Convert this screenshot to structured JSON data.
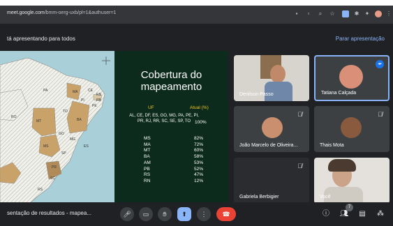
{
  "browser": {
    "url_host": "meet.google.com",
    "url_rest": "/bmm-oerg-uxb/pl=1&authuser=1"
  },
  "presenting": {
    "text": "tá apresentando para todos",
    "stop_label": "Parar apresentação"
  },
  "slide": {
    "title_line1": "Cobertura do",
    "title_line2": "mapeamento",
    "col_uf": "UF",
    "col_atual": "Atual (%)",
    "full_states": "AL, CE, DF, ES, GO, MG, PA, PE, PI, PR, RJ, RR, SC, SE, SP, TO",
    "full_pct": "100%",
    "rows": [
      {
        "uf": "MS",
        "val": "82%"
      },
      {
        "uf": "MA",
        "val": "72%"
      },
      {
        "uf": "MT",
        "val": "60%"
      },
      {
        "uf": "BA",
        "val": "58%"
      },
      {
        "uf": "AM",
        "val": "53%"
      },
      {
        "uf": "PB",
        "val": "52%"
      },
      {
        "uf": "RS",
        "val": "47%"
      },
      {
        "uf": "RN",
        "val": "12%"
      }
    ]
  },
  "map": {
    "labels": [
      "PA",
      "MA",
      "CE",
      "RN",
      "PB",
      "PE",
      "PI",
      "TO",
      "BA",
      "MT",
      "MS",
      "GO",
      "MG",
      "SP",
      "PR",
      "SC",
      "RS",
      "RO",
      "ES"
    ]
  },
  "participants": [
    {
      "name": "Denilson Passo",
      "muted": false
    },
    {
      "name": "Tatiana Calçada",
      "muted": false
    },
    {
      "name": "João Marcelo de Oliveira...",
      "muted": true
    },
    {
      "name": "Thais Mota",
      "muted": true
    },
    {
      "name": "Gabriela Berbigier",
      "muted": true
    },
    {
      "name": "Você",
      "muted": false
    }
  ],
  "bottom": {
    "meeting_title": "sentação de resultados - mapea...",
    "people_count": "7"
  },
  "colors": {
    "background": "#202124",
    "accent": "#8ab4f8",
    "end_call": "#ea4335",
    "slide_bg": "#0c2b1d",
    "header_yellow": "#f5c518"
  }
}
